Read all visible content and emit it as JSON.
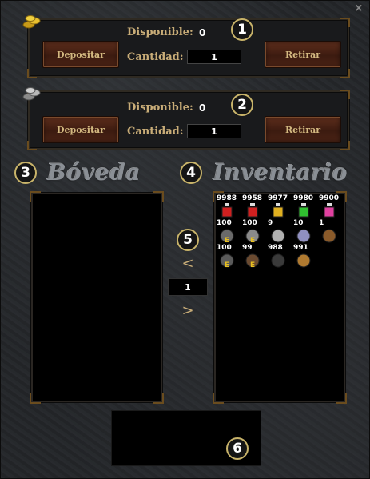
{
  "close": {
    "icon": "close-icon",
    "glyph": "×"
  },
  "gold": {
    "icon": "gold-coins-icon",
    "deposit_label": "Depositar",
    "withdraw_label": "Retirar",
    "available_label": "Disponible:",
    "available_value": "0",
    "quantity_label": "Cantidad:",
    "quantity_value": "1",
    "badge": "1"
  },
  "silver": {
    "icon": "silver-coins-icon",
    "deposit_label": "Depositar",
    "withdraw_label": "Retirar",
    "available_label": "Disponible:",
    "available_value": "0",
    "quantity_label": "Cantidad:",
    "quantity_value": "1",
    "badge": "2"
  },
  "vault": {
    "title": "Bóveda",
    "badge": "3"
  },
  "inventory": {
    "title": "Inventario",
    "badge": "4",
    "items": [
      {
        "count": "9988",
        "icon": "red-potion-icon",
        "color": "#d02020",
        "equipped": ""
      },
      {
        "count": "9958",
        "icon": "red-potion-icon",
        "color": "#d02020",
        "equipped": ""
      },
      {
        "count": "9977",
        "icon": "yellow-potion-icon",
        "color": "#e0b020",
        "equipped": ""
      },
      {
        "count": "9980",
        "icon": "green-potion-icon",
        "color": "#30c030",
        "equipped": ""
      },
      {
        "count": "9900",
        "icon": "pink-potion-icon",
        "color": "#e040a0",
        "equipped": ""
      },
      {
        "count": "100",
        "icon": "armor-icon",
        "color": "#6a6a6a",
        "equipped": "E"
      },
      {
        "count": "100",
        "icon": "axe-icon",
        "color": "#8a8a8a",
        "equipped": "E"
      },
      {
        "count": "9",
        "icon": "shield-icon",
        "color": "#b0b0b0",
        "equipped": ""
      },
      {
        "count": "10",
        "icon": "ring-icon",
        "color": "#9090c0",
        "equipped": ""
      },
      {
        "count": "1",
        "icon": "barrel-icon",
        "color": "#8a5a2a",
        "equipped": ""
      },
      {
        "count": "100",
        "icon": "helmet-icon",
        "color": "#5a5a5a",
        "equipped": "E"
      },
      {
        "count": "99",
        "icon": "club-icon",
        "color": "#6a4a30",
        "equipped": "E"
      },
      {
        "count": "988",
        "icon": "bomb-icon",
        "color": "#3a3a3a",
        "equipped": ""
      },
      {
        "count": "991",
        "icon": "roast-chicken-icon",
        "color": "#b07a30",
        "equipped": ""
      }
    ]
  },
  "transfer": {
    "badge": "5",
    "left_arrow": "<",
    "right_arrow": ">",
    "amount": "1"
  },
  "info": {
    "badge": "6"
  }
}
